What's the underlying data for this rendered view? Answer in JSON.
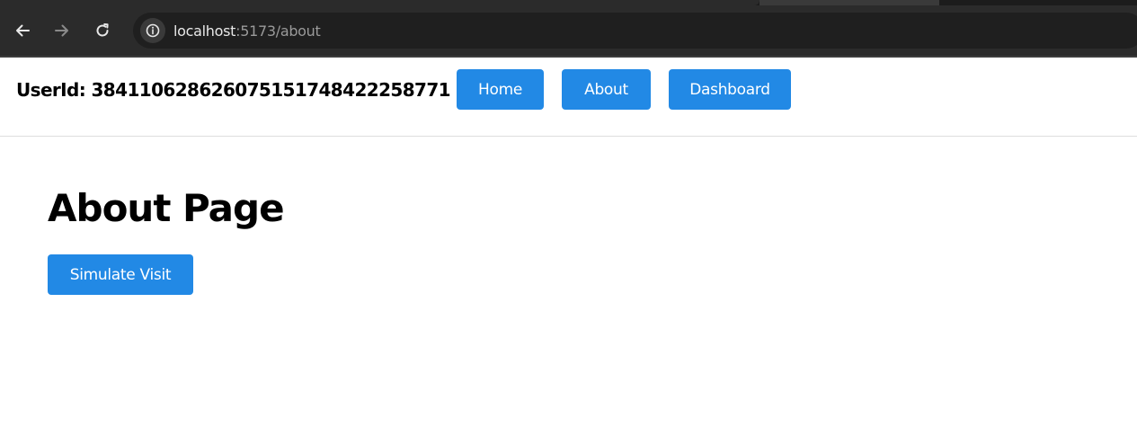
{
  "browser": {
    "url_host": "localhost",
    "url_path": ":5173/about",
    "icons": {
      "back": "arrow-left-icon",
      "forward": "arrow-right-icon",
      "reload": "reload-icon",
      "site_info": "info-icon"
    }
  },
  "header": {
    "user_id": "UserId: 384110628626075151748422258771",
    "nav": {
      "home": "Home",
      "about": "About",
      "dashboard": "Dashboard"
    }
  },
  "main": {
    "title": "About Page",
    "simulate_button": "Simulate Visit"
  },
  "colors": {
    "accent": "#2289e5",
    "chrome_bg": "#2b2b2b"
  }
}
